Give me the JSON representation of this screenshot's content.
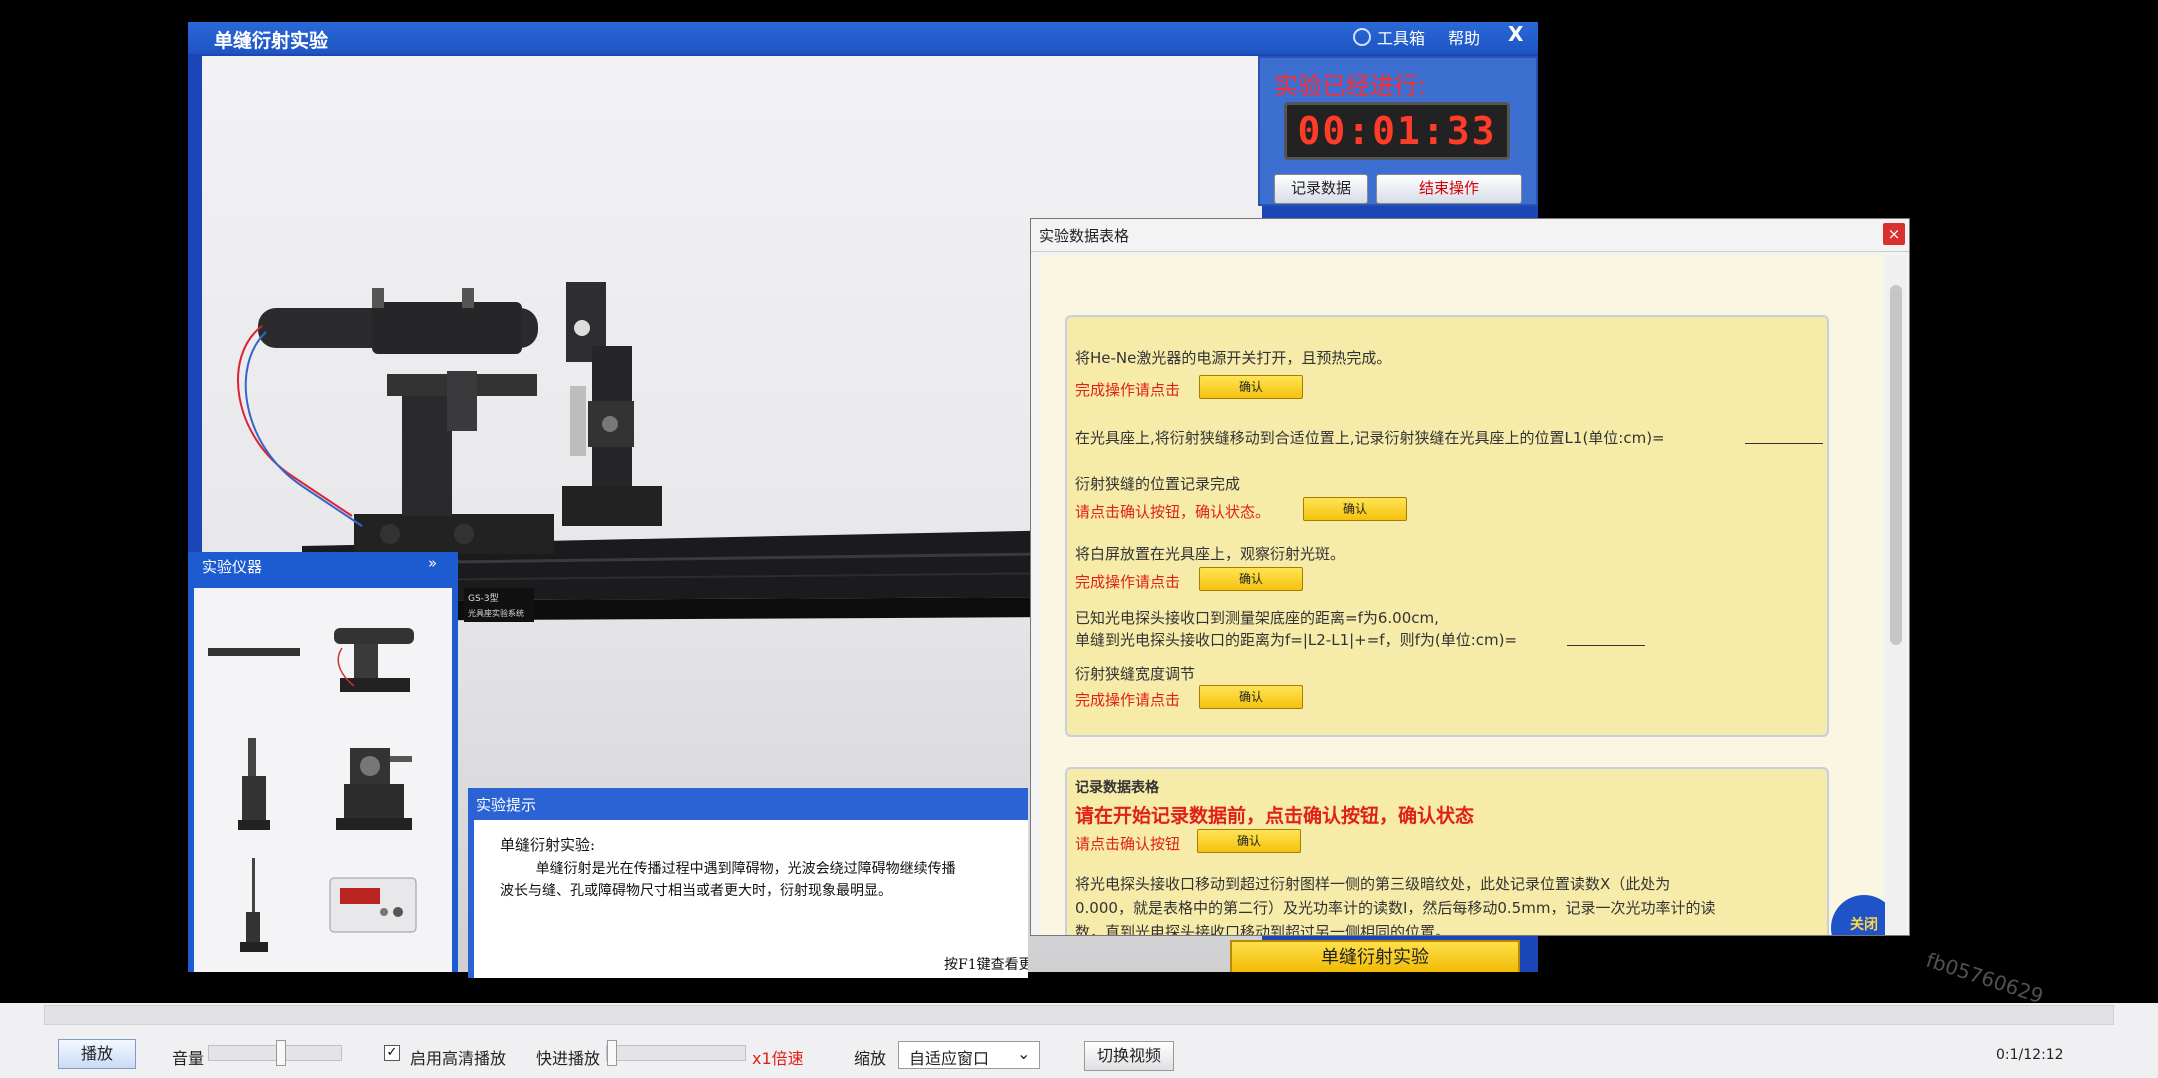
{
  "app": {
    "title": "单缝衍射实验",
    "toolbox_label": "工具箱",
    "help_label": "帮助",
    "close_label": "X"
  },
  "timer": {
    "label": "实验已经进行:",
    "value": "00:01:33",
    "record_button": "记录数据",
    "end_button": "结束操作"
  },
  "equipment_label": {
    "line1": "GS-3型",
    "line2": "光具座实验系统"
  },
  "instrument_panel": {
    "title": "实验仪器",
    "collapse_icon": "double-chevron-down-icon",
    "items": [
      "optical-rail",
      "laser-on-mount",
      "slit-holder",
      "photodetector-stand",
      "probe-stand",
      "power-meter"
    ]
  },
  "hint": {
    "title": "实验提示",
    "heading": "单缝衍射实验:",
    "text": "        单缝衍射是光在传播过程中遇到障碍物，光波会绕过障碍物继续传播\n波长与缝、孔或障碍物尺寸相当或者更大时，衍射现象最明显。",
    "footer": "按F1键查看更"
  },
  "experiment_button": "单缝衍射实验",
  "data_table": {
    "title": "实验数据表格",
    "close_label": "×",
    "section1": {
      "step1_text": "将He-Ne激光器的电源开关打开，且预热完成。",
      "step1_prompt": "完成操作请点击",
      "step2_text": "在光具座上,将衍射狭缝移动到合适位置上,记录衍射狭缝在光具座上的位置L1(单位:cm)=",
      "step3_text": "衍射狭缝的位置记录完成",
      "step3_prompt": "请点击确认按钮，确认状态。",
      "step4_text": "将白屏放置在光具座上，观察衍射光斑。",
      "step4_prompt": "完成操作请点击",
      "step5_text1": "已知光电探头接收口到测量架底座的距离=f为6.00cm,",
      "step5_text2": "单缝到光电探头接收口的距离为f=|L2-L1|+=f，则f为(单位:cm)=",
      "step6_text": "衍射狭缝宽度调节",
      "step6_prompt": "完成操作请点击"
    },
    "confirm_label": "确认",
    "section2": {
      "title": "记录数据表格",
      "warning": "请在开始记录数据前，点击确认按钮，确认状态",
      "prompt": "请点击确认按钮",
      "desc_line1": "        将光电探头接收口移动到超过衍射图样一侧的第三级暗纹处，此处记录位置读数X（此处为",
      "desc_line2": "0.000，就是表格中的第二行）及光功率计的读数I，然后每移动0.5mm，记录一次光功率计的读",
      "desc_line3": "数，直到光电探头接收口移动到超过另一侧相同的位置。"
    },
    "close_bubble": "关闭"
  },
  "player": {
    "play_label": "播放",
    "volume_label": "音量",
    "volume_level": 0.55,
    "hd_checked": true,
    "hd_label": "启用高清播放",
    "fast_label": "快进播放",
    "speed_label": "x1倍速",
    "zoom_label": "缩放",
    "zoom_value": "自适应窗口",
    "switch_label": "切换视频",
    "time": "0:1/12:12"
  },
  "watermark": "fb05760629"
}
